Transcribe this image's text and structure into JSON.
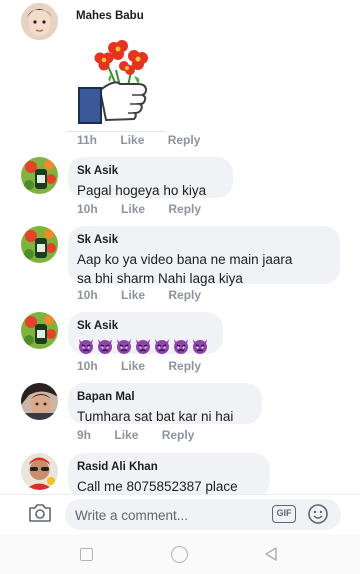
{
  "comments": [
    {
      "author": "Mahes Babu",
      "time": "11h",
      "like": "Like",
      "reply": "Reply",
      "sticker": "flower-thumbs-up-sticker"
    },
    {
      "author": "Sk Asik",
      "text": "Pagal hogeya ho kiya",
      "time": "10h",
      "like": "Like",
      "reply": "Reply"
    },
    {
      "author": "Sk Asik",
      "text_line1": "Aap ko ya video bana ne main jaara",
      "text_line2": "sa bhi sharm Nahi laga kiya",
      "time": "10h",
      "like": "Like",
      "reply": "Reply"
    },
    {
      "author": "Sk Asik",
      "emoji_count": 7,
      "emoji": "angry-devil-emoji",
      "time": "10h",
      "like": "Like",
      "reply": "Reply"
    },
    {
      "author": "Bapan Mal",
      "text": "Tumhara sat bat kar ni hai",
      "time": "9h",
      "like": "Like",
      "reply": "Reply"
    },
    {
      "author": "Rasid Ali Khan",
      "text": "Call me 8075852387 place"
    }
  ],
  "composer": {
    "placeholder": "Write a comment...",
    "gif_label": "GIF"
  },
  "colors": {
    "bubble": "#f0f2f5",
    "meta_text": "#8d949e",
    "devil_purple": "#8e44ad"
  }
}
